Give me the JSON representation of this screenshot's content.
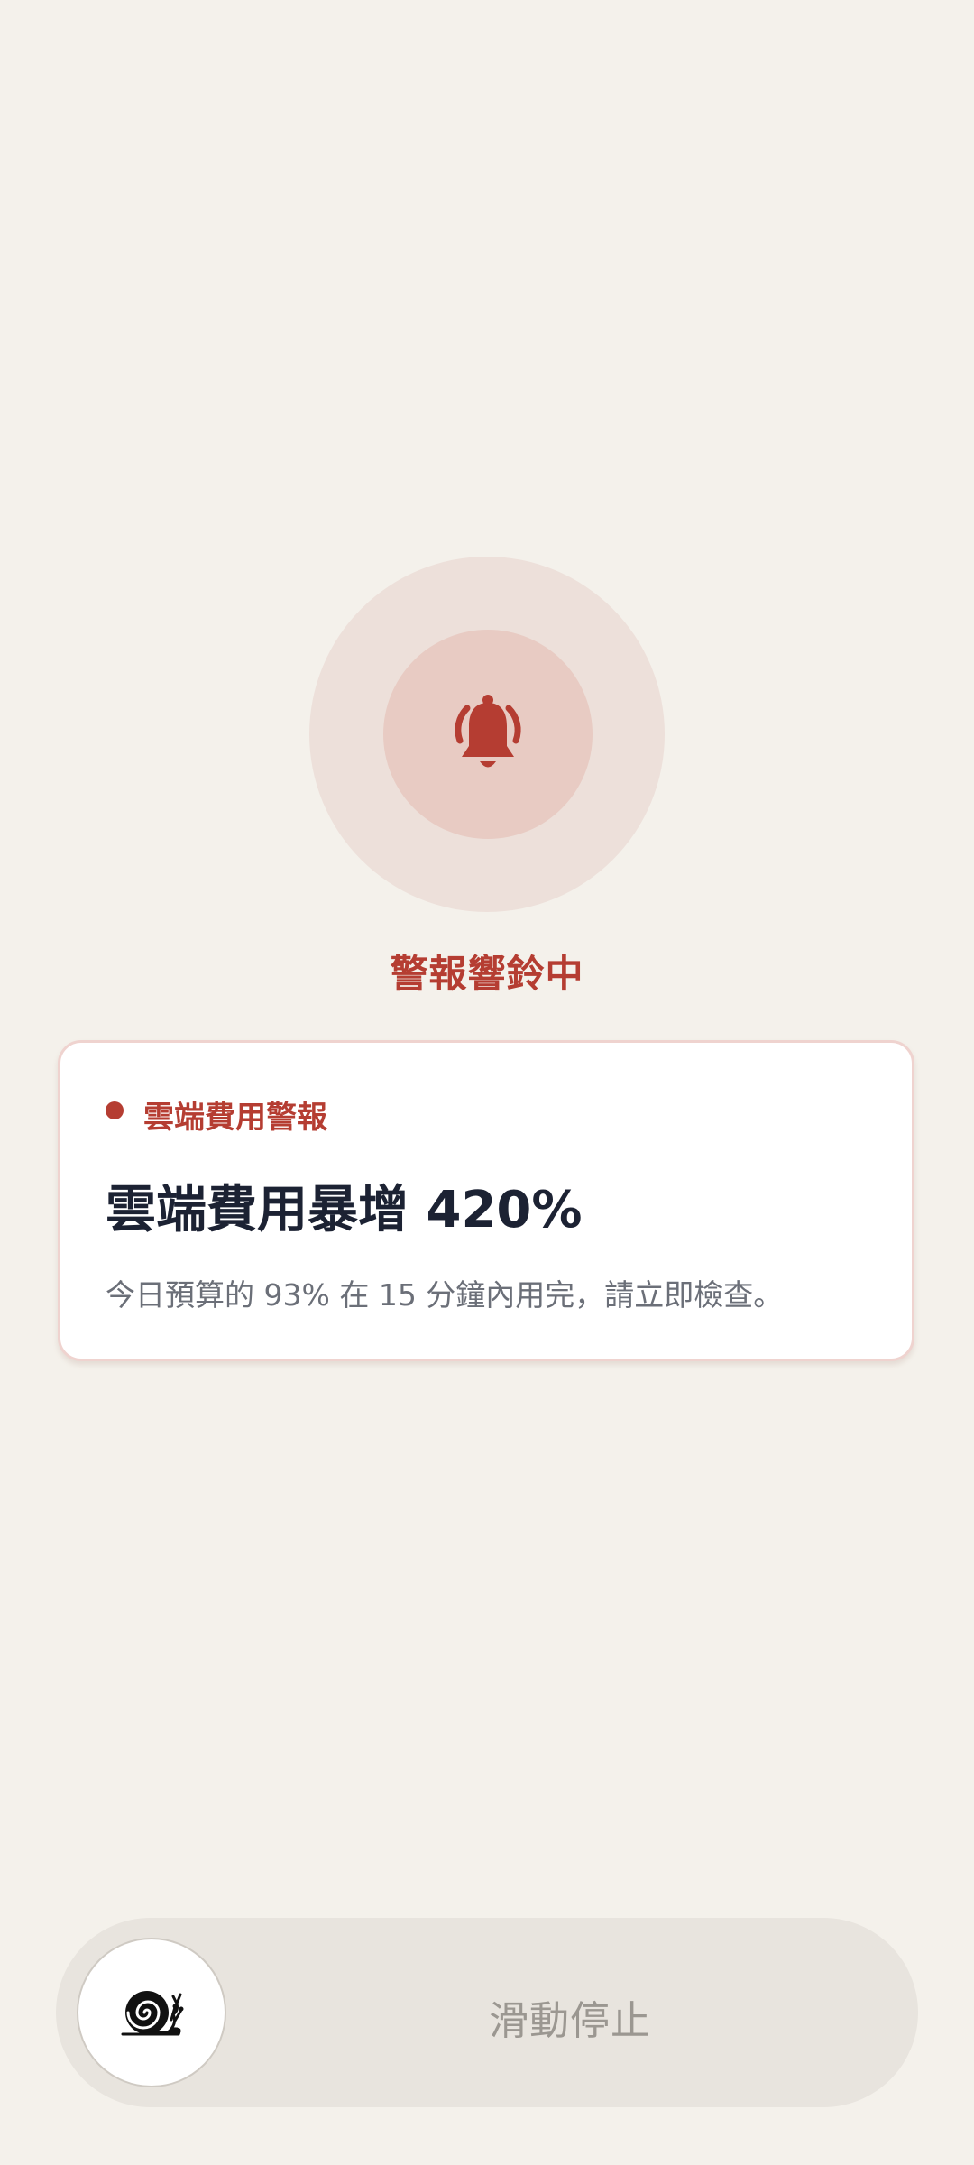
{
  "alarm": {
    "status_label": "警報響鈴中",
    "icon": "bell-ringing-icon",
    "accent_color": "#b53d32"
  },
  "card": {
    "tag": "雲端費用警報",
    "title": "雲端費用暴增 420%",
    "description": "今日預算的 93% 在 15 分鐘內用完，請立即檢查。"
  },
  "slider": {
    "label": "滑動停止",
    "knob_icon": "snail-icon"
  }
}
